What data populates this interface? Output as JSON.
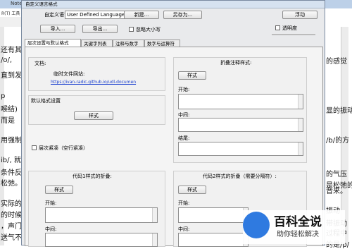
{
  "background": {
    "title": "Notepad",
    "menu_fragment": "R(T)  工具",
    "left_lines": [
      "还有其",
      "/o/, ",
      "直到发",
      "  p",
      "喉结)",
      "  而是",
      "用强制",
      "ib/, 就",
      "条件反",
      "松弛。而",
      "实际的",
      "的时候",
      "，声门",
      "送气不"
    ],
    "right_lines": [
      "的感觉",
      "显的振动",
      "/b/的方",
      "的气压",
      "是松弛的",
      "音来。",
      "振动",
      "带振动",
      "过程中",
      "的是/p/"
    ]
  },
  "dialog": {
    "title": "自定义语言格式",
    "language_label": "自定义语言：",
    "language_value": "User Defined Language",
    "new_button": "新建...",
    "save_as_button": "另存为...",
    "float_button": "浮动",
    "import_button": "导入...",
    "export_button": "导出...",
    "ignore_case_label": "忽略大小写",
    "transparency_label": "透明度",
    "tabs": [
      "层次设置与默认格式",
      "关键字列表",
      "注释与数字",
      "数字与运算符"
    ],
    "documents_label": "文档:",
    "temp_site_label": "临时文件网站:",
    "temp_site_url": "https://ivan-radic.github.io/udl-documen",
    "default_style_label": "默认格式设置",
    "style_button": "样式",
    "fold_compact_label": "层次紧凑（空行紧凑）",
    "fold_comment_title": "折叠注释样式:",
    "open_label": "开始:",
    "middle_label": "中间:",
    "close_label": "结尾:",
    "code1_title": "代码1样式的折叠:",
    "code2_title": "代码2样式的折叠（需要分隔符）:"
  },
  "watermark": {
    "title": "百科全说",
    "subtitle": "助你轻松解决"
  }
}
